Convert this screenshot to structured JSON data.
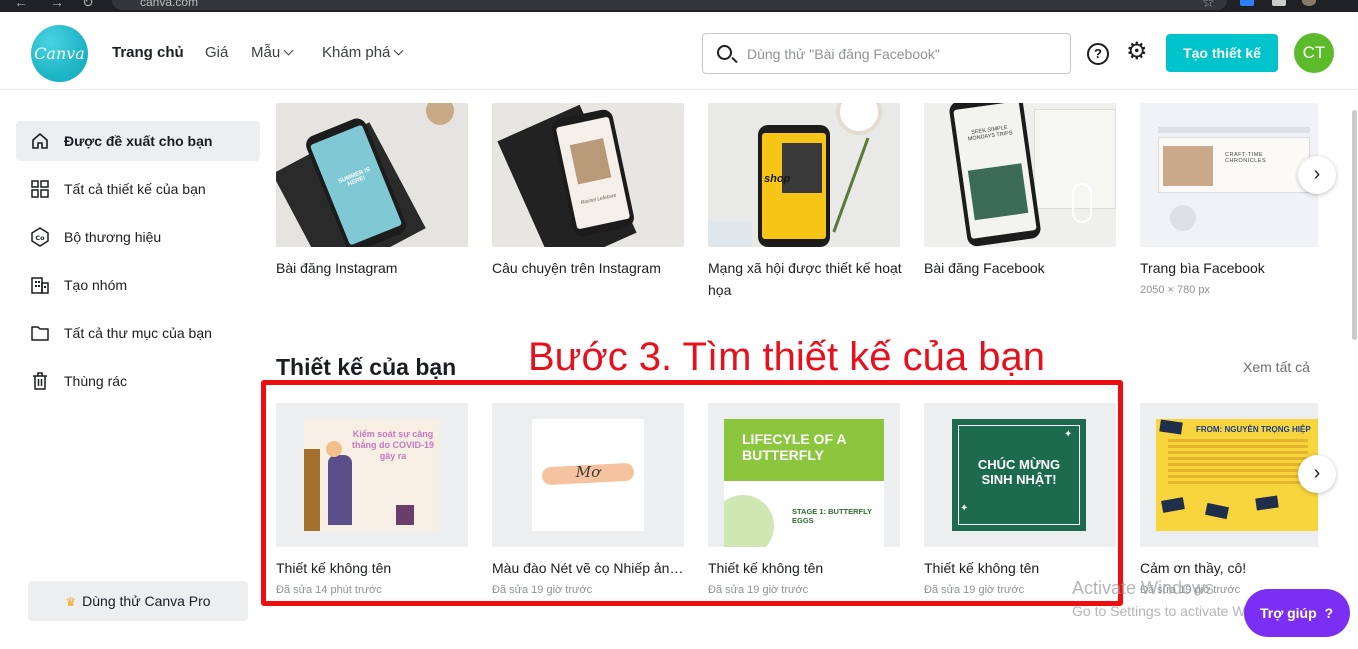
{
  "browser": {
    "url": "canva.com"
  },
  "header": {
    "logo_text": "Canva",
    "nav": [
      {
        "label": "Trang chủ"
      },
      {
        "label": "Giá"
      },
      {
        "label": "Mẫu"
      },
      {
        "label": "Khám phá"
      }
    ],
    "search_placeholder": "Dùng thử \"Bài đăng Facebook\"",
    "help_glyph": "?",
    "create_label": "Tạo thiết kế",
    "avatar_initials": "CT",
    "avatar_color": "#5bbb2b",
    "accent_color": "#00c4cc"
  },
  "sidebar": {
    "items": [
      {
        "label": "Được đề xuất cho bạn",
        "icon": "home-icon"
      },
      {
        "label": "Tất cả thiết kế của bạn",
        "icon": "grid-icon"
      },
      {
        "label": "Bộ thương hiệu",
        "icon": "brand-kit-icon"
      },
      {
        "label": "Tạo nhóm",
        "icon": "building-icon"
      },
      {
        "label": "Tất cả thư mục của bạn",
        "icon": "folder-icon"
      },
      {
        "label": "Thùng rác",
        "icon": "trash-icon"
      }
    ],
    "try_pro_label": "Dùng thử Canva Pro"
  },
  "templates": [
    {
      "title": "Bài đăng Instagram",
      "sub": "",
      "thumb_text": "SUMMER IS HERE!"
    },
    {
      "title": "Câu chuyện trên Instagram",
      "sub": "",
      "thumb_text": "Rachel Lefebvre"
    },
    {
      "title": "Mạng xã hội được thiết kế hoạt họa",
      "sub": "",
      "thumb_text": "shop"
    },
    {
      "title": "Bài đăng Facebook",
      "sub": "",
      "thumb_text": "SEEK SIMPLE MONDAYS TRIPS"
    },
    {
      "title": "Trang bìa Facebook",
      "sub": "2050 × 780 px",
      "thumb_text": "CRAFT-TIME CHRONICLES"
    }
  ],
  "designs_section": {
    "title": "Thiết kế của bạn",
    "see_all": "Xem tất cả",
    "annotation": "Bước 3. Tìm thiết kế của bạn",
    "annotation_color": "#e8101d",
    "items": [
      {
        "title": "Thiết kế không tên",
        "sub": "Đã sửa 14 phút trước",
        "thumb_text": "Kiểm soát sự căng thẳng do COVID-19 gây ra"
      },
      {
        "title": "Màu đào Nét vẽ cọ Nhiếp ảnh Logo",
        "sub": "Đã sửa 19 giờ trước",
        "thumb_text": "Mơ"
      },
      {
        "title": "Thiết kế không tên",
        "sub": "Đã sửa 19 giờ trước",
        "thumb_text": "LIFECYLE OF A BUTTERFLY",
        "thumb_text2": "STAGE 1: BUTTERFLY EGGS"
      },
      {
        "title": "Thiết kế không tên",
        "sub": "Đã sửa 19 giờ trước",
        "thumb_text": "CHÚC MỪNG SINH NHẬT!"
      },
      {
        "title": "Cảm ơn thầy, cô!",
        "sub": "Đã sửa 19 giờ trước",
        "thumb_text": "FROM: NGUYỄN TRỌNG HIỆP"
      }
    ]
  },
  "watermark": {
    "line1": "Activate Windows",
    "line2": "Go to Settings to activate Windows."
  },
  "help_fab": {
    "label": "Trợ giúp",
    "glyph": "?"
  }
}
